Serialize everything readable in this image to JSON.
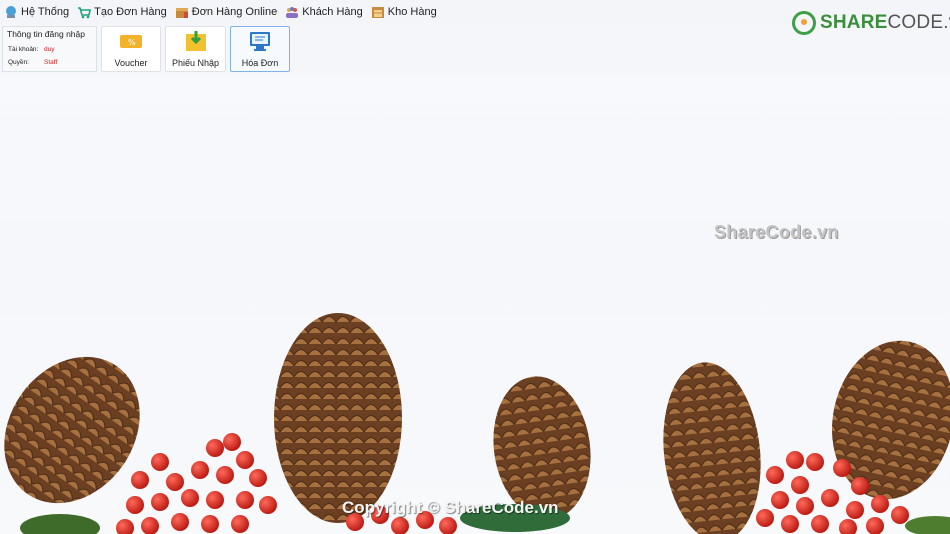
{
  "menu": [
    {
      "label": "Hệ Thống",
      "icon": "system-icon"
    },
    {
      "label": "Tạo Đơn Hàng",
      "icon": "cart-icon"
    },
    {
      "label": "Đơn Hàng Online",
      "icon": "box-icon"
    },
    {
      "label": "Khách Hàng",
      "icon": "customers-icon"
    },
    {
      "label": "Kho Hàng",
      "icon": "warehouse-icon"
    }
  ],
  "login": {
    "title": "Thông tin đăng nhập",
    "account_label": "Tài khoản:",
    "account_value": "duy",
    "role_label": "Quyền:",
    "role_value": "Staff"
  },
  "ribbon": {
    "buttons": [
      {
        "label": "Voucher",
        "icon": "voucher-icon"
      },
      {
        "label": "Phiếu Nhập",
        "icon": "import-slip-icon"
      },
      {
        "label": "Hóa Đơn",
        "icon": "invoice-icon"
      }
    ]
  },
  "branding": {
    "logo_prefix": "SHARE",
    "logo_suffix": "CODE.vn",
    "watermark": "ShareCode.vn",
    "copyright": "Copyright © ShareCode.vn"
  },
  "colors": {
    "accent": "#7fb5e6",
    "login_value": "#dd2222",
    "logo_green": "#3b8f3c",
    "berry_red": "#d7261e"
  }
}
